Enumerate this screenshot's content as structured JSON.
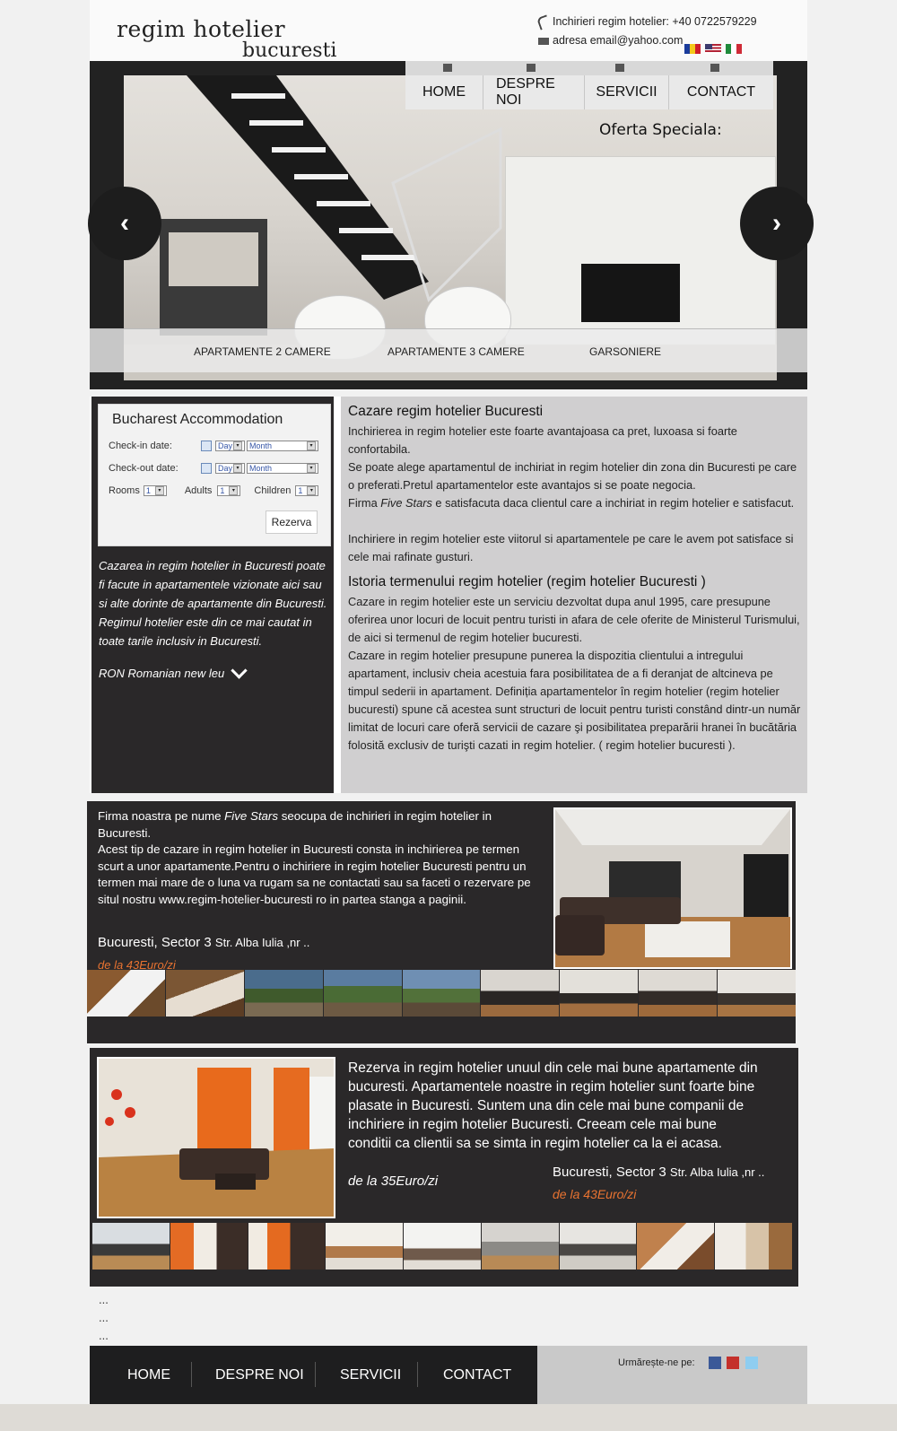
{
  "logo": {
    "line1": "regim hotelier",
    "line2": "bucuresti"
  },
  "header": {
    "phone": "Inchirieri regim hotelier: +40 0722579229",
    "email": "adresa email@yahoo.com"
  },
  "nav": {
    "items": [
      {
        "label": "HOME"
      },
      {
        "label": "DESPRE NOI"
      },
      {
        "label": "SERVICII"
      },
      {
        "label": "CONTACT"
      }
    ]
  },
  "hero": {
    "special_offer": "Oferta Speciala:",
    "categories": [
      "APARTAMENTE 2 CAMERE",
      "APARTAMENTE 3 CAMERE",
      "GARSONIERE"
    ]
  },
  "booking": {
    "title": "Bucharest Accommodation",
    "checkin_label": "Check-in date:",
    "checkout_label": "Check-out date:",
    "day": "Day",
    "month": "Month",
    "rooms_label": "Rooms",
    "adults_label": "Adults",
    "children_label": "Children",
    "rooms_value": "1",
    "adults_value": "1",
    "children_value": "1",
    "submit": "Rezerva"
  },
  "sidebar": {
    "text": "Cazarea in regim hotelier in Bucuresti poate fi facute in apartamentele vizionate aici sau si alte dorinte de apartamente din Bucuresti. Regimul hotelier este din ce mai cautat in toate tarile inclusiv in Bucuresti.",
    "currency": "RON Romanian new leu"
  },
  "article": {
    "heading1": "Cazare regim hotelier Bucuresti",
    "p1": "Inchirierea in regim hotelier este foarte avantajoasa ca pret, luxoasa si foarte confortabila.",
    "p2": "Se poate alege apartamentul de inchiriat in regim hotelier din zona din Bucuresti pe care o preferati.Pretul apartamentelor este avantajos si se poate negocia.",
    "p3a": "Firma ",
    "p3_brand": "Five Stars",
    "p3b": " e satisfacuta daca clientul care a inchiriat in regim hotelier e satisfacut.",
    "p4": "Inchiriere in regim hotelier este viitorul si apartamentele pe care le avem pot satisface si cele mai rafinate gusturi.",
    "heading2": "Istoria termenului regim hotelier (regim hotelier Bucuresti )",
    "p5": "Cazare in regim hotelier este un serviciu dezvoltat dupa anul 1995, care presupune oferirea unor locuri de locuit pentru turisti in afara de cele oferite de Ministerul Turismului, de aici si termenul de regim hotelier bucuresti.",
    "p6": "Cazare in regim hotelier presupune punerea la dispozitia clientului a intregului apartament, inclusiv cheia acestuia fara posibilitatea de a fi deranjat de altcineva pe timpul sederii in apartament. Definiția apartamentelor în regim hotelier  (regim hotelier bucuresti) spune că acestea sunt structuri de locuit pentru turisti constând dintr-un număr limitat de locuri care oferă servicii de cazare şi posibilitatea preparării hranei în bucătăria folosită exclusiv de turişti cazati in regim hotelier. ( regim hotelier bucuresti )."
  },
  "offer1": {
    "text_a": "Firma noastra pe nume ",
    "brand": "Five Stars",
    "text_b": " seocupa de inchirieri in regim hotelier in Bucuresti.",
    "text_c": "Acest tip de cazare in regim hotelier in Bucuresti consta in inchirierea pe termen scurt a unor apartamente.Pentru o inchiriere in regim hotelier Bucuresti pentru un termen mai mare de o luna va rugam sa ne contactati sau sa faceti o rezervare pe situl nostru  www.regim-hotelier-bucuresti ro in partea stanga a paginii.",
    "location": "Bucuresti, Sector 3",
    "street": "Str. Alba Iulia ,nr ..",
    "price": "de la 43Euro/zi"
  },
  "offer2": {
    "text": "Rezerva in regim hotelier unuul din cele mai bune apartamente din bucuresti. Apartamentele noastre in regim hotelier sunt foarte bine plasate in Bucuresti. Suntem una din cele mai bune companii de inchiriere in regim hotelier Bucuresti. Creeam cele mai bune conditii ca clientii sa se simta in regim hotelier ca la ei acasa.",
    "price_left": "de la 35Euro/zi",
    "location": "Bucuresti, Sector 3",
    "street": "Str. Alba Iulia ,nr ..",
    "price_right": "de la 43Euro/zi"
  },
  "ellipsis": [
    "...",
    "...",
    "..."
  ],
  "footer": {
    "nav": [
      "HOME",
      "DESPRE NOI",
      "SERVICII",
      "CONTACT"
    ],
    "follow": "Urmărește-ne pe:"
  },
  "colors": {
    "accent_price": "#e87331",
    "dark_panel": "#2a2829",
    "article_bg": "#d0cfd0"
  }
}
